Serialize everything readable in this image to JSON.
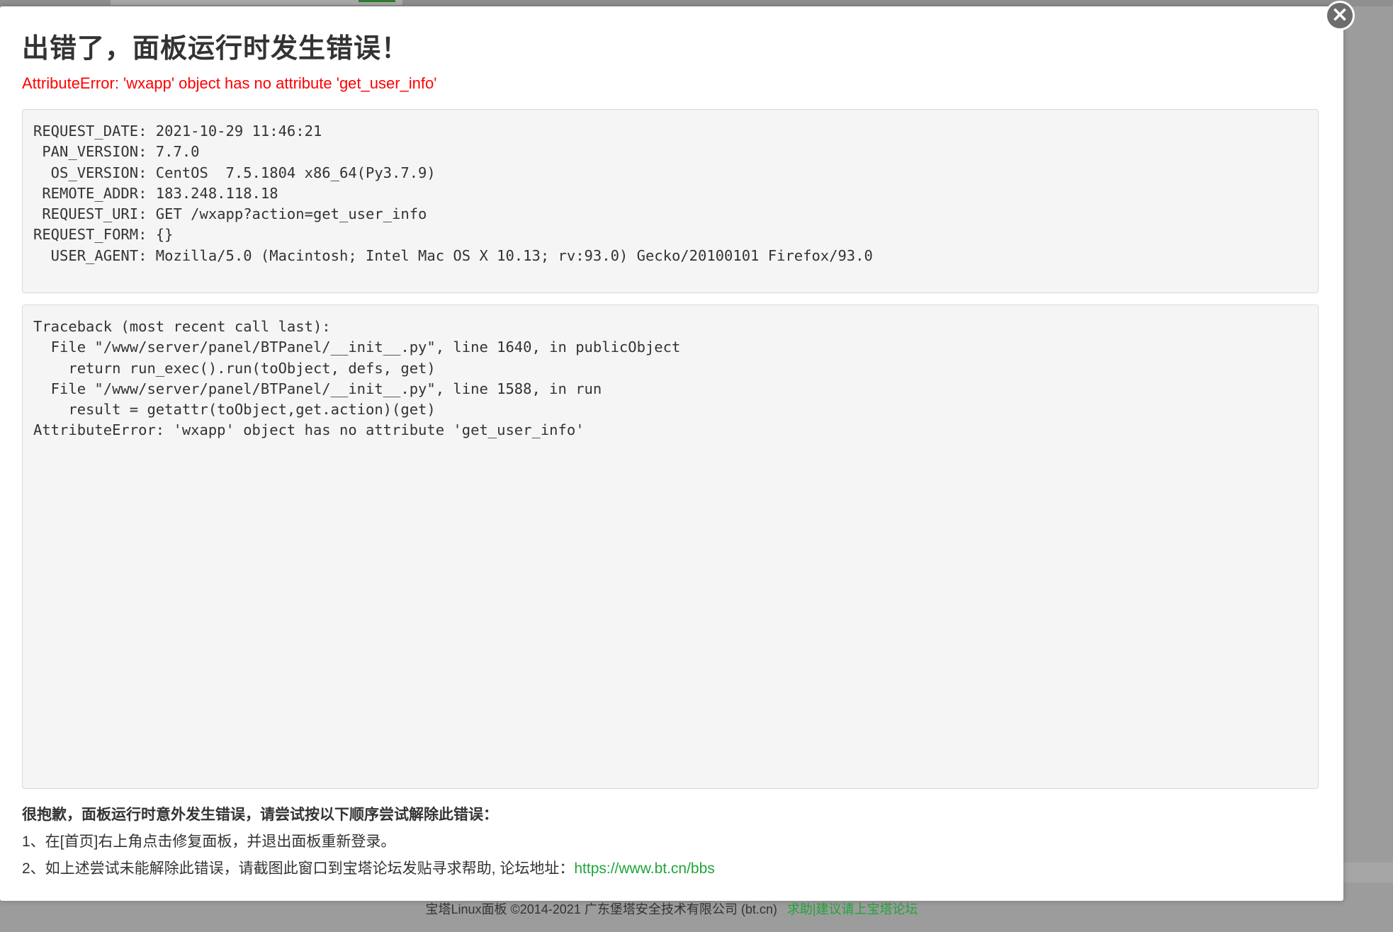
{
  "dialog": {
    "title": "出错了，面板运行时发生错误！",
    "error_message": "AttributeError: 'wxapp' object has no attribute 'get_user_info'",
    "close_label": "×",
    "request_info": "REQUEST_DATE: 2021-10-29 11:46:21\n PAN_VERSION: 7.7.0\n  OS_VERSION: CentOS  7.5.1804 x86_64(Py3.7.9)\n REMOTE_ADDR: 183.248.118.18\n REQUEST_URI: GET /wxapp?action=get_user_info\nREQUEST_FORM: {}\n  USER_AGENT: Mozilla/5.0 (Macintosh; Intel Mac OS X 10.13; rv:93.0) Gecko/20100101 Firefox/93.0",
    "traceback": "Traceback (most recent call last):\n  File \"/www/server/panel/BTPanel/__init__.py\", line 1640, in publicObject\n    return run_exec().run(toObject, defs, get)\n  File \"/www/server/panel/BTPanel/__init__.py\", line 1588, in run\n    result = getattr(toObject,get.action)(get)\nAttributeError: 'wxapp' object has no attribute 'get_user_info'",
    "help": {
      "heading": "很抱歉，面板运行时意外发生错误，请尝试按以下顺序尝试解除此错误：",
      "step1": "1、在[首页]右上角点击修复面板，并退出面板重新登录。",
      "step2": "2、如上述尝试未能解除此错误，请截图此窗口到宝塔论坛发贴寻求帮助, 论坛地址：",
      "forum_link": "https://www.bt.cn/bbs"
    }
  },
  "footer": {
    "copyright": "宝塔Linux面板 ©2014-2021 广东堡塔安全技术有限公司 (bt.cn)",
    "link": "求助|建议请上宝塔论坛"
  },
  "colors": {
    "error": "#ff0000",
    "link": "#20a53a",
    "overlay": "#9c9c9c"
  },
  "icons": {
    "close": "close-icon"
  }
}
